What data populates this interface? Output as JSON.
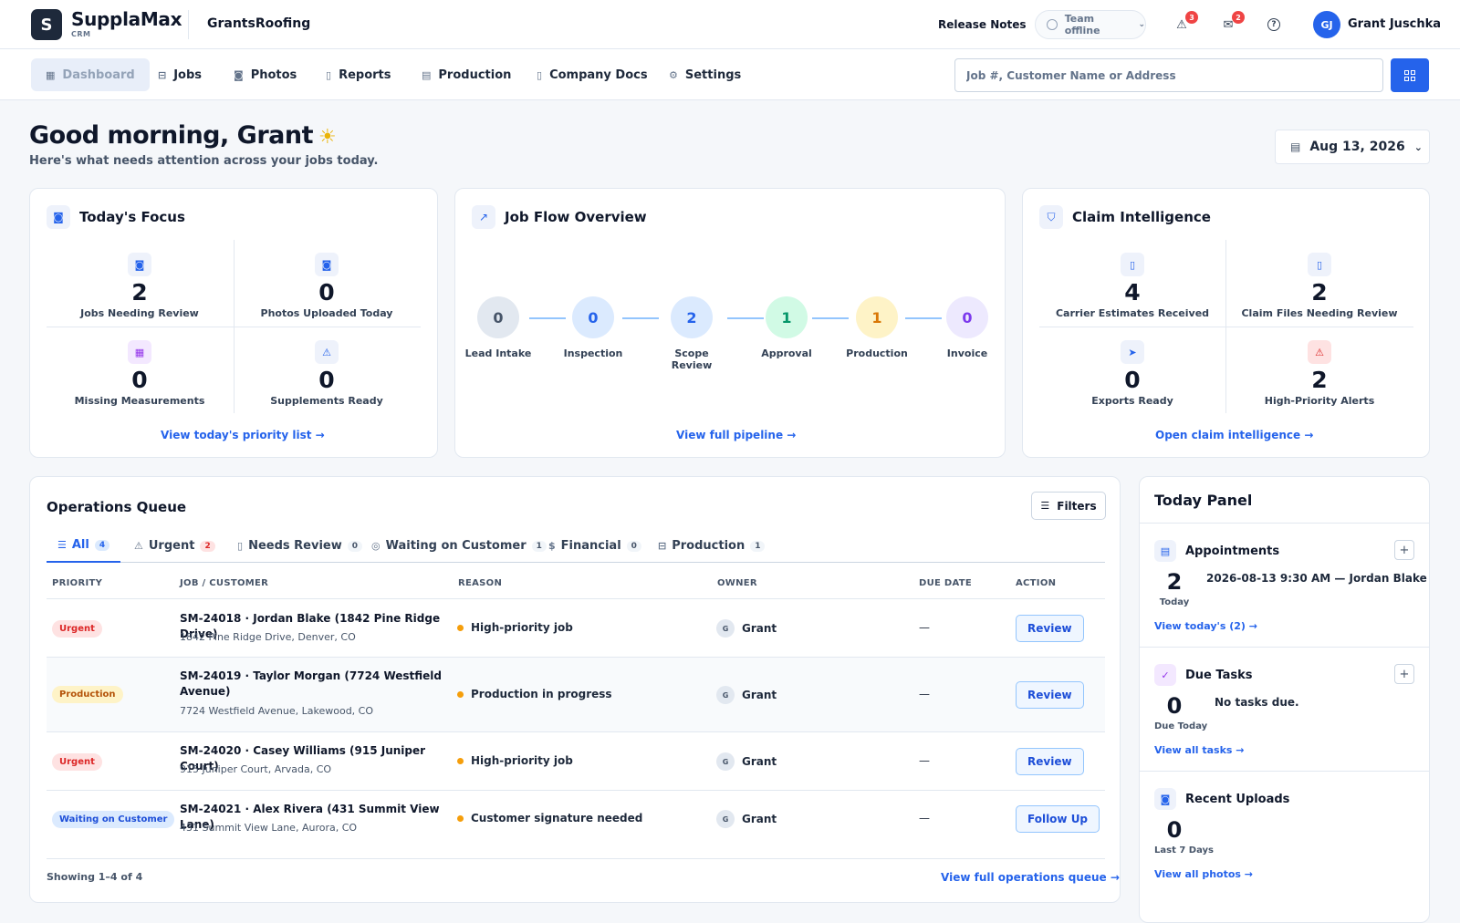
{
  "header": {
    "logo_letter": "S",
    "brand": "SupplaMax",
    "brand_sub": "CRM",
    "company": "GrantsRoofing",
    "release_notes": "Release Notes",
    "team_status": "Team offline",
    "alerts_count": "3",
    "messages_count": "2",
    "user_initials": "GJ",
    "user_name": "Grant Juschka"
  },
  "nav": {
    "items": [
      {
        "label": "Dashboard",
        "icon": "grid-icon"
      },
      {
        "label": "Jobs",
        "icon": "briefcase-icon"
      },
      {
        "label": "Photos",
        "icon": "camera-icon"
      },
      {
        "label": "Reports",
        "icon": "document-icon"
      },
      {
        "label": "Production",
        "icon": "calendar-icon"
      },
      {
        "label": "Company Docs",
        "icon": "document-icon"
      },
      {
        "label": "Settings",
        "icon": "gear-icon"
      }
    ],
    "search_placeholder": "Job #, Customer Name or Address"
  },
  "greeting": {
    "title": "Good morning, Grant",
    "subtitle": "Here's what needs attention across your jobs today.",
    "date": "Aug 13, 2026"
  },
  "focus": {
    "title": "Today's Focus",
    "metrics": [
      {
        "value": "2",
        "label": "Jobs Needing Review",
        "icon": "camera-icon"
      },
      {
        "value": "0",
        "label": "Photos Uploaded Today",
        "icon": "camera-icon"
      },
      {
        "value": "0",
        "label": "Missing Measurements",
        "icon": "calculator-icon"
      },
      {
        "value": "0",
        "label": "Supplements Ready",
        "icon": "warning-icon"
      }
    ],
    "link": "View today's priority list →"
  },
  "pipeline": {
    "title": "Job Flow Overview",
    "stages": [
      {
        "label": "Lead Intake",
        "value": "0",
        "bg": "#e2e8f0",
        "fg": "#475569"
      },
      {
        "label": "Inspection",
        "value": "0",
        "bg": "#dbeafe",
        "fg": "#2563eb"
      },
      {
        "label": "Scope Review",
        "value": "2",
        "bg": "#dbeafe",
        "fg": "#2563eb"
      },
      {
        "label": "Approval",
        "value": "1",
        "bg": "#d1fae5",
        "fg": "#059669"
      },
      {
        "label": "Production",
        "value": "1",
        "bg": "#fef3c7",
        "fg": "#d97706"
      },
      {
        "label": "Invoice",
        "value": "0",
        "bg": "#ede9fe",
        "fg": "#7c3aed"
      }
    ],
    "link": "View full pipeline →"
  },
  "claims": {
    "title": "Claim Intelligence",
    "metrics": [
      {
        "value": "4",
        "label": "Carrier Estimates Received",
        "icon": "document-icon"
      },
      {
        "value": "2",
        "label": "Claim Files Needing Review",
        "icon": "document-icon"
      },
      {
        "value": "0",
        "label": "Exports Ready",
        "icon": "send-icon"
      },
      {
        "value": "2",
        "label": "High-Priority Alerts",
        "icon": "warning-icon"
      }
    ],
    "link": "Open claim intelligence →"
  },
  "queue": {
    "title": "Operations Queue",
    "filters_label": "Filters",
    "tabs": [
      {
        "label": "All",
        "count": "4"
      },
      {
        "label": "Urgent",
        "count": "2"
      },
      {
        "label": "Needs Review",
        "count": "0"
      },
      {
        "label": "Waiting on Customer",
        "count": "1"
      },
      {
        "label": "Financial",
        "count": "0"
      },
      {
        "label": "Production",
        "count": "1"
      }
    ],
    "columns": [
      "PRIORITY",
      "JOB / CUSTOMER",
      "REASON",
      "OWNER",
      "DUE DATE",
      "ACTION"
    ],
    "rows": [
      {
        "priority": "Urgent",
        "job": "SM-24018 · Jordan Blake (1842 Pine Ridge Drive)",
        "address": "1842 Pine Ridge Drive, Denver, CO",
        "reason": "High-priority job",
        "owner_initial": "G",
        "owner": "Grant",
        "due": "—",
        "action": "Review"
      },
      {
        "priority": "Production",
        "job": "SM-24019 · Taylor Morgan (7724 Westfield Avenue)",
        "address": "7724 Westfield Avenue, Lakewood, CO",
        "reason": "Production in progress",
        "owner_initial": "G",
        "owner": "Grant",
        "due": "—",
        "action": "Review"
      },
      {
        "priority": "Urgent",
        "job": "SM-24020 · Casey Williams (915 Juniper Court)",
        "address": "915 Juniper Court, Arvada, CO",
        "reason": "High-priority job",
        "owner_initial": "G",
        "owner": "Grant",
        "due": "—",
        "action": "Review"
      },
      {
        "priority": "Waiting on Customer",
        "job": "SM-24021 · Alex Rivera (431 Summit View Lane)",
        "address": "431 Summit View Lane, Aurora, CO",
        "reason": "Customer signature needed",
        "owner_initial": "G",
        "owner": "Grant",
        "due": "—",
        "action": "Follow Up"
      }
    ],
    "showing": "Showing 1–4 of 4",
    "link": "View full operations queue →"
  },
  "today": {
    "title": "Today Panel",
    "appointments": {
      "title": "Appointments",
      "value": "2",
      "sub": "Today",
      "text": "2026-08-13 9:30 AM — Jordan Blake",
      "link": "View today's (2) →"
    },
    "tasks": {
      "title": "Due Tasks",
      "value": "0",
      "sub": "Due Today",
      "text": "No tasks due.",
      "link": "View all tasks →"
    },
    "uploads": {
      "title": "Recent Uploads",
      "value": "0",
      "sub": "Last 7 Days",
      "link": "View all photos →"
    }
  }
}
